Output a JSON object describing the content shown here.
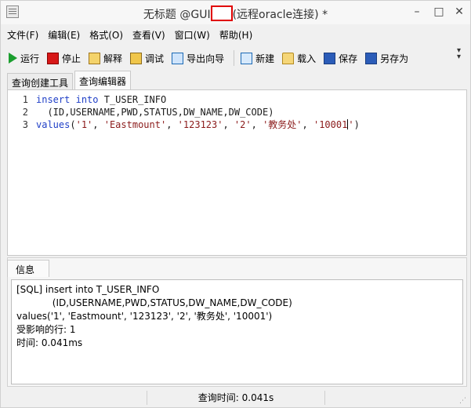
{
  "window": {
    "title_left": "无标题 @GUI",
    "title_right": "(远程oracle连接) *",
    "min": "–",
    "max": "□",
    "close": "✕"
  },
  "menu": [
    {
      "label": "文件(F)"
    },
    {
      "label": "编辑(E)"
    },
    {
      "label": "格式(O)"
    },
    {
      "label": "查看(V)"
    },
    {
      "label": "窗口(W)"
    },
    {
      "label": "帮助(H)"
    }
  ],
  "toolbar": {
    "run": "运行",
    "stop": "停止",
    "explain": "解释",
    "debug": "调试",
    "export": "导出向导",
    "new": "新建",
    "load": "载入",
    "save": "保存",
    "saveas": "另存为",
    "more": "»"
  },
  "tabs": [
    {
      "label": "查询创建工具"
    },
    {
      "label": "查询编辑器"
    }
  ],
  "editor": {
    "lines": [
      {
        "num": "1",
        "text": "insert into T_USER_INFO"
      },
      {
        "num": "2",
        "text": "  (ID,USERNAME,PWD,STATUS,DW_NAME,DW_CODE)"
      },
      {
        "num": "3",
        "text": "values('1', 'Eastmount', '123123', '2', '教务处', '10001')"
      }
    ],
    "line1_kw1": "insert",
    "line1_kw2": "into",
    "line1_rest": " T_USER_INFO",
    "line3_kw": "values",
    "line3_p1": "(",
    "line3_s1": "'1'",
    "line3_s2": "'Eastmount'",
    "line3_s3": "'123123'",
    "line3_s4": "'2'",
    "line3_s5": "'教务处'",
    "line3_s6a": "'10001",
    "line3_s6b": "'",
    "line3_end": ")"
  },
  "info": {
    "tab_label": "信息",
    "lines": [
      "[SQL] insert into T_USER_INFO",
      "            (ID,USERNAME,PWD,STATUS,DW_NAME,DW_CODE)",
      "values('1', 'Eastmount', '123123', '2', '教务处', '10001')",
      "受影响的行: 1",
      "时间: 0.041ms"
    ]
  },
  "status": {
    "query_time": "查询时间: 0.041s"
  }
}
